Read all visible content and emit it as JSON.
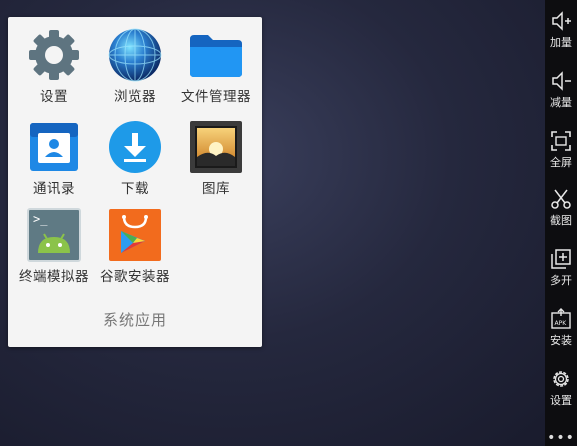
{
  "folder": {
    "title": "系统应用",
    "apps": [
      {
        "label": "设置",
        "icon": "settings-gear-icon"
      },
      {
        "label": "浏览器",
        "icon": "browser-globe-icon"
      },
      {
        "label": "文件管理器",
        "icon": "folder-icon"
      },
      {
        "label": "通讯录",
        "icon": "contacts-icon"
      },
      {
        "label": "下载",
        "icon": "download-icon"
      },
      {
        "label": "图库",
        "icon": "gallery-icon"
      },
      {
        "label": "终端模拟器",
        "icon": "terminal-android-icon"
      },
      {
        "label": "谷歌安装器",
        "icon": "installer-bag-icon"
      }
    ]
  },
  "sidebar": {
    "items": [
      {
        "label": "加量",
        "icon": "volume-up-icon"
      },
      {
        "label": "减量",
        "icon": "volume-down-icon"
      },
      {
        "label": "全屏",
        "icon": "fullscreen-icon"
      },
      {
        "label": "截图",
        "icon": "scissors-icon"
      },
      {
        "label": "多开",
        "icon": "multi-open-icon"
      },
      {
        "label": "安装",
        "icon": "apk-install-icon"
      },
      {
        "label": "设置",
        "icon": "gear-icon"
      }
    ],
    "more": "•••"
  },
  "colors": {
    "sidebar_bg": "#0d0d10",
    "panel_bg": "#f4f4f4",
    "accent_blue": "#1e88e5"
  }
}
